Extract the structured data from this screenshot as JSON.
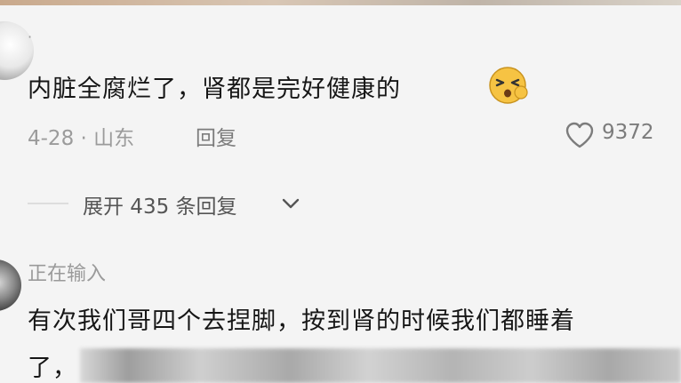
{
  "comments": [
    {
      "username": "·",
      "text": "内脏全腐烂了，肾都是完好健康的",
      "emoji": "face-with-symbols-emoji",
      "date_location": "4-28 · 山东",
      "reply_label": "回复",
      "like_count": "9372",
      "expand_label": "展开 435 条回复"
    },
    {
      "username": "正在输入",
      "text_line1": "有次我们哥四个去捏脚，按到肾的时候我们都睡着",
      "text_line2": "了，"
    }
  ],
  "colors": {
    "background": "#f4f4f4",
    "text_primary": "#161616",
    "text_meta": "#9b9b9b",
    "text_action": "#7c7c7c"
  }
}
